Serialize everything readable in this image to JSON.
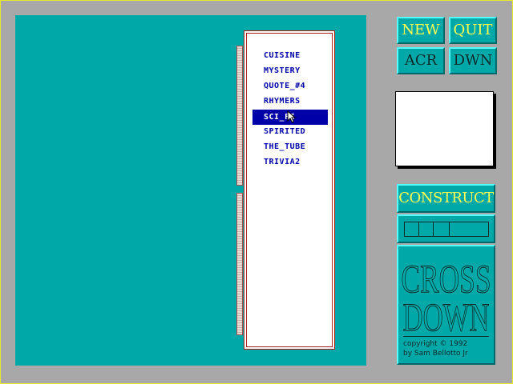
{
  "buttons": {
    "new": "NEW",
    "quit": "QUIT",
    "across": "ACR",
    "down": "DWN",
    "construct": "CONSTRUCT"
  },
  "puzzle_list": {
    "items": [
      "CUISINE",
      "MYSTERY",
      "QUOTE_#4",
      "RHYMERS",
      "SCI_FI",
      "SPIRITED",
      "THE_TUBE",
      "TRIVIA2"
    ],
    "selected": "SCI_FI"
  },
  "logo": {
    "line1": "CROSS",
    "line2": "DOWN",
    "copyright": "copyright © 1992",
    "author": "by Sam Bellotto Jr"
  },
  "progress_segments": 4,
  "colors": {
    "board": "#00a8a8",
    "background": "#a8a8a8",
    "selection": "#0000a8",
    "button_text": "#fcfc54"
  }
}
